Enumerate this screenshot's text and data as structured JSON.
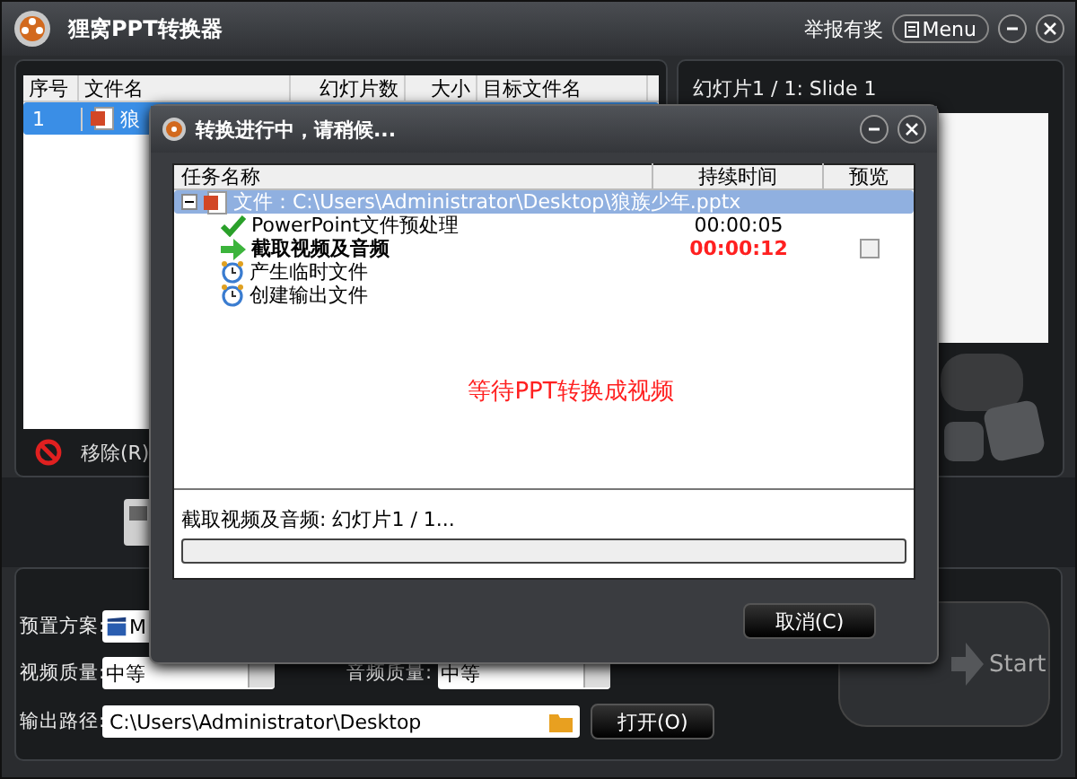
{
  "window": {
    "title": "狸窝PPT转换器",
    "report_link": "举报有奖",
    "menu_button": "Menu"
  },
  "file_table": {
    "columns": [
      "序号",
      "文件名",
      "幻灯片数",
      "大小",
      "目标文件名"
    ],
    "rows": [
      {
        "index": "1",
        "file_name": "狼",
        "selected": true
      }
    ]
  },
  "remove_button": "移除(R)",
  "preview": {
    "slide_label": "幻灯片1 / 1: Slide 1"
  },
  "settings": {
    "preset_label": "预置方案:",
    "preset_value": "M",
    "video_quality_label": "视频质量:",
    "video_quality_value": "中等",
    "audio_quality_label": "音频质量:",
    "audio_quality_value": "中等",
    "output_path_label": "输出路径:",
    "output_path_value": "C:\\Users\\Administrator\\Desktop",
    "open_button": "打开(O)"
  },
  "start_button": "Start",
  "dialog": {
    "title": "转换进行中，请稍候...",
    "columns": [
      "任务名称",
      "持续时间",
      "预览"
    ],
    "file_node": {
      "label": "文件：C:\\Users\\Administrator\\Desktop\\狼族少年.pptx",
      "expanded": true,
      "selected": true,
      "children": [
        {
          "label": "PowerPoint文件预处理",
          "kind": "done",
          "duration": "00:00:05"
        },
        {
          "label": "截取视频及音频",
          "kind": "active",
          "duration": "00:00:12",
          "preview_checked": false
        },
        {
          "label": "产生临时文件",
          "kind": "pending"
        },
        {
          "label": "创建输出文件",
          "kind": "pending"
        }
      ]
    },
    "message": "等待PPT转换成视频",
    "status": "截取视频及音频: 幻灯片1 / 1...",
    "progress": {
      "level": 0
    },
    "cancel_button": "取消(C)"
  }
}
